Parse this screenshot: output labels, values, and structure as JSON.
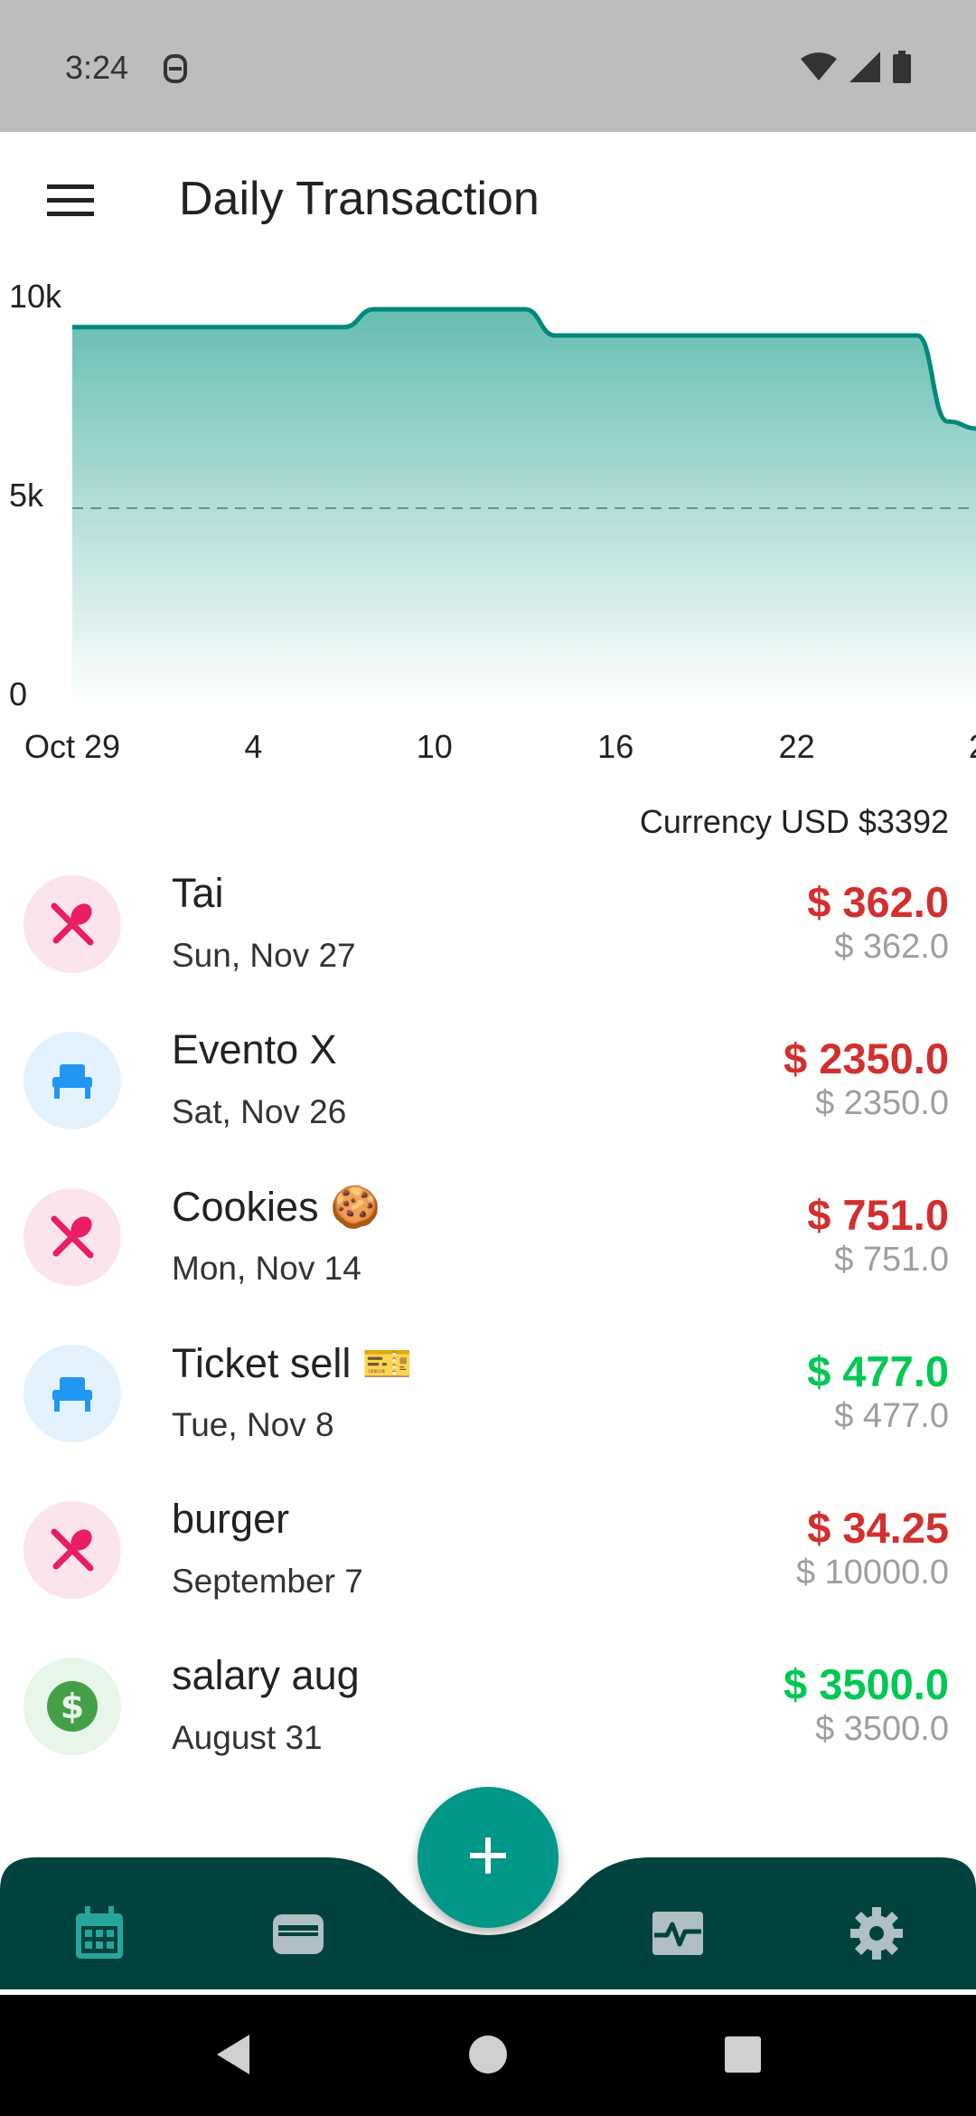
{
  "status_bar": {
    "time": "3:24"
  },
  "app_bar": {
    "title": "Daily Transaction"
  },
  "chart_data": {
    "type": "area",
    "y_ticks": [
      "10k",
      "5k",
      "0"
    ],
    "x_ticks": [
      "Oct 29",
      "4",
      "10",
      "16",
      "22",
      "2"
    ],
    "ylim": [
      0,
      10000
    ],
    "x": [
      "Oct 29",
      "Nov 7",
      "Nov 8",
      "Nov 13",
      "Nov 14",
      "Nov 26",
      "Nov 27",
      "Nov 28",
      "Nov 29",
      "Dec 1"
    ],
    "values": [
      9550,
      9550,
      10000,
      10000,
      9340,
      9340,
      7180,
      7000,
      6710,
      6710
    ],
    "reference_line": 5000,
    "colors": {
      "line": "#00897b",
      "fill_top": "#66bdb2",
      "fill_bottom": "#ffffff"
    }
  },
  "summary": {
    "currency_text": "Currency USD $3392"
  },
  "transactions": [
    {
      "icon": "fork-knife-icon",
      "title": "Tai",
      "date": "Sun, Nov 27",
      "amount": "$ 362.0",
      "original": "$ 362.0",
      "type": "expense"
    },
    {
      "icon": "armchair-icon",
      "title": "Evento X",
      "date": "Sat, Nov 26",
      "amount": "$ 2350.0",
      "original": "$ 2350.0",
      "type": "expense"
    },
    {
      "icon": "fork-knife-icon",
      "title": "Cookies 🍪",
      "date": "Mon, Nov 14",
      "amount": "$ 751.0",
      "original": "$ 751.0",
      "type": "expense"
    },
    {
      "icon": "armchair-icon",
      "title": "Ticket sell 🎫",
      "date": "Tue, Nov 8",
      "amount": "$ 477.0",
      "original": "$ 477.0",
      "type": "income"
    },
    {
      "icon": "fork-knife-icon",
      "title": "burger",
      "date": "September 7",
      "amount": "$ 34.25",
      "original": "$ 10000.0",
      "type": "expense"
    },
    {
      "icon": "dollar-icon",
      "title": "salary aug",
      "date": "August 31",
      "amount": "$ 3500.0",
      "original": "$ 3500.0",
      "type": "income"
    }
  ],
  "bottom_nav": {
    "items": [
      {
        "icon": "calendar-icon",
        "active": true
      },
      {
        "icon": "wallet-icon",
        "active": false
      },
      {
        "icon": "add-icon",
        "active": false
      },
      {
        "icon": "activity-icon",
        "active": false
      },
      {
        "icon": "gear-icon",
        "active": false
      }
    ],
    "colors": {
      "bar": "#00423d",
      "active": "#26a69a",
      "inactive": "#b0bec5"
    }
  }
}
